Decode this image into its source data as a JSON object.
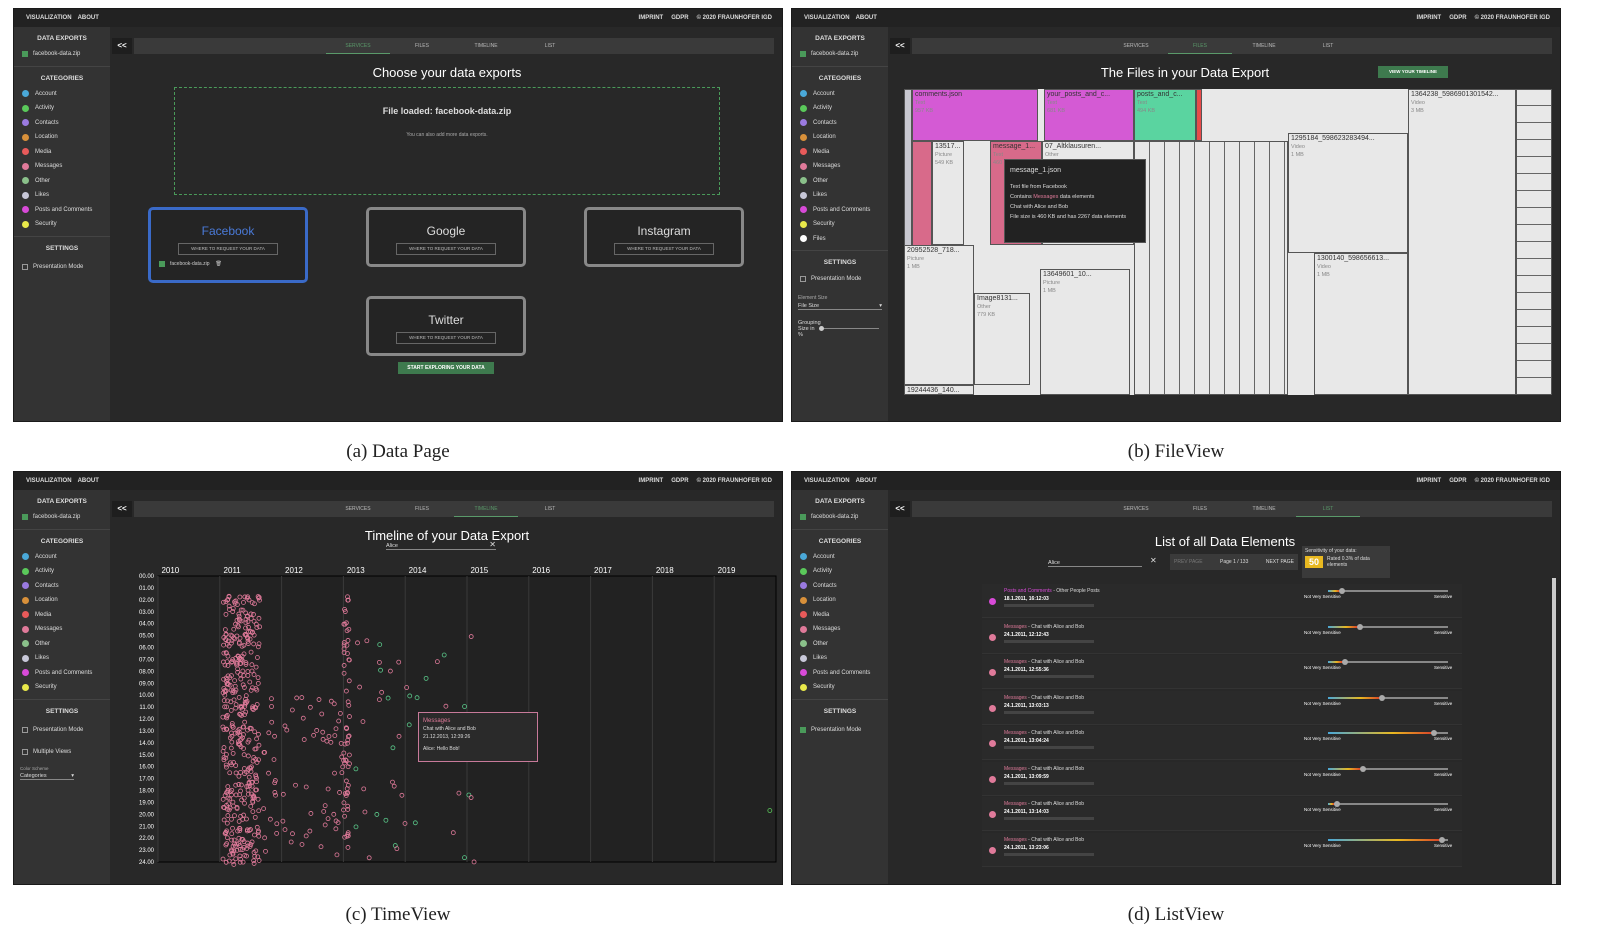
{
  "topbar": {
    "left": [
      "VISUALIZATION",
      "ABOUT"
    ],
    "right": [
      "IMPRINT",
      "GDPR",
      "© 2020 FRAUNHOFER IGD"
    ]
  },
  "sidebar": {
    "exports_heading": "DATA EXPORTS",
    "export_file": "facebook-data.zip",
    "categories_heading": "CATEGORIES",
    "categories": [
      {
        "label": "Account",
        "color": "#4aa8d8"
      },
      {
        "label": "Activity",
        "color": "#5ac85a"
      },
      {
        "label": "Contacts",
        "color": "#9a7ae0"
      },
      {
        "label": "Location",
        "color": "#d8903a"
      },
      {
        "label": "Media",
        "color": "#e85a5a"
      },
      {
        "label": "Messages",
        "color": "#e07a9a"
      },
      {
        "label": "Other",
        "color": "#8ac08a"
      },
      {
        "label": "Likes",
        "color": "#c8c8d8"
      },
      {
        "label": "Posts and Comments",
        "color": "#d84ad8"
      },
      {
        "label": "Security",
        "color": "#e8e84a"
      }
    ],
    "files_category": {
      "label": "Files",
      "color": "#ffffff"
    },
    "settings_heading": "SETTINGS",
    "presentation_mode": "Presentation Mode",
    "multiple_views": "Multiple Views",
    "color_scheme_label": "Color Scheme",
    "color_scheme_value": "Categories",
    "element_size_label": "Element Size",
    "element_size_value": "File Size",
    "grouping_label": "Grouping",
    "size_in_label": "Size in",
    "percent_sign": "%"
  },
  "tabs": {
    "back": "<<",
    "items": [
      "SERVICES",
      "FILES",
      "TIMELINE",
      "LIST"
    ]
  },
  "data_page": {
    "title": "Choose your data exports",
    "dropzone_title": "File loaded: facebook-data.zip",
    "dropzone_sub": "You can also add more data exports.",
    "services": [
      {
        "name": "Facebook",
        "link": "WHERE TO REQUEST YOUR DATA"
      },
      {
        "name": "Google",
        "link": "WHERE TO REQUEST YOUR DATA"
      },
      {
        "name": "Instagram",
        "link": "WHERE TO REQUEST YOUR DATA"
      },
      {
        "name": "Twitter",
        "link": "WHERE TO REQUEST YOUR DATA"
      }
    ],
    "loaded_file": "facebook-data.zip",
    "start_button": "START EXPLORING YOUR DATA",
    "caption": "(a) Data Page"
  },
  "file_view": {
    "title": "The Files in your Data Export",
    "timeline_button": "VIEW YOUR TIMELINE",
    "tiles": [
      {
        "name": "comments.json",
        "type": "Text",
        "size": "957 KB"
      },
      {
        "name": "your_posts_and_c...",
        "type": "Text",
        "size": "681 KB"
      },
      {
        "name": "posts_and_c...",
        "type": "Text",
        "size": "494 KB"
      },
      {
        "name": "1364238_5986901301542...",
        "type": "Video",
        "size": "3 MB"
      },
      {
        "name": "1295184_598623283494...",
        "type": "Video",
        "size": "1 MB"
      },
      {
        "name": "13517...",
        "type": "Picture",
        "size": "549 KB"
      },
      {
        "name": "message_1...",
        "type": "Text",
        "size": "460"
      },
      {
        "name": "07_Altklausuren...",
        "type": "Other",
        "size": ""
      },
      {
        "name": "20952528_718...",
        "type": "Picture",
        "size": "1 MB"
      },
      {
        "name": "13649601_10...",
        "type": "Picture",
        "size": "1 MB"
      },
      {
        "name": "1300140_598656613...",
        "type": "Video",
        "size": "1 MB"
      },
      {
        "name": "Image8131...",
        "type": "Other",
        "size": "779 KB"
      },
      {
        "name": "19244436_140...",
        "type": "",
        "size": ""
      }
    ],
    "tooltip": {
      "title": "message_1.json",
      "line1": "Text file from Facebook",
      "line2a": "Contains",
      "line2b": "Messages",
      "line2c": "data elements",
      "line3": "Chat with Alice and Bob",
      "line4": "File size is 460 KB and has 2267 data elements"
    },
    "caption": "(b) FileView"
  },
  "time_view": {
    "title": "Timeline of your Data Export",
    "filter": "Alice",
    "clear": "✕",
    "years": [
      "2010",
      "2011",
      "2012",
      "2013",
      "2014",
      "2015",
      "2016",
      "2017",
      "2018",
      "2019"
    ],
    "hours": [
      "00.00",
      "01.00",
      "02.00",
      "03.00",
      "04.00",
      "05.00",
      "06.00",
      "07.00",
      "08.00",
      "09.00",
      "10.00",
      "11.00",
      "12.00",
      "13.00",
      "14.00",
      "15.00",
      "16.00",
      "17.00",
      "18.00",
      "19.00",
      "20.00",
      "21.00",
      "22.00",
      "23.00",
      "24.00"
    ],
    "tooltip": {
      "category": "Messages",
      "chat": "Chat with Alice and Bob",
      "date": "21.12.2013, 12:39:26",
      "text": "Alice: Hello Bob!"
    },
    "caption": "(c) TimeView"
  },
  "list_view": {
    "title": "List of all Data Elements",
    "filter": "Alice",
    "clear": "✕",
    "prev": "PREV PAGE",
    "page": "Page 1 / 133",
    "next": "NEXT PAGE",
    "sensitivity_title": "Sensitivity of your data:",
    "sensitivity_value": "50",
    "sensitivity_text": "Rated 0.3% of data elements",
    "left_label": "Not Very Sensitive",
    "right_label": "Sensitive",
    "rows": [
      {
        "cat": "Posts and Comments",
        "sub": "Other People Posts",
        "date": "18.1.2011, 16:12:03",
        "dot": "#d84ad8",
        "level": 0.1
      },
      {
        "cat": "Messages",
        "sub": "Chat with Alice and Bob",
        "date": "24.1.2011, 12:12:43",
        "dot": "#e07a9a",
        "level": 0.25
      },
      {
        "cat": "Messages",
        "sub": "Chat with Alice and Bob",
        "date": "24.1.2011, 12:55:36",
        "dot": "#e07a9a",
        "level": 0.12
      },
      {
        "cat": "Messages",
        "sub": "Chat with Alice and Bob",
        "date": "24.1.2011, 13:03:13",
        "dot": "#e07a9a",
        "level": 0.45
      },
      {
        "cat": "Messages",
        "sub": "Chat with Alice and Bob",
        "date": "24.1.2011, 13:04:24",
        "dot": "#e07a9a",
        "level": 0.9
      },
      {
        "cat": "Messages",
        "sub": "Chat with Alice and Bob",
        "date": "24.1.2011, 13:09:59",
        "dot": "#e07a9a",
        "level": 0.28
      },
      {
        "cat": "Messages",
        "sub": "Chat with Alice and Bob",
        "date": "24.1.2011, 13:14:03",
        "dot": "#e07a9a",
        "level": 0.05
      },
      {
        "cat": "Messages",
        "sub": "Chat with Alice and Bob",
        "date": "24.1.2011, 13:23:06",
        "dot": "#e07a9a",
        "level": 0.97
      }
    ],
    "caption": "(d) ListView"
  }
}
